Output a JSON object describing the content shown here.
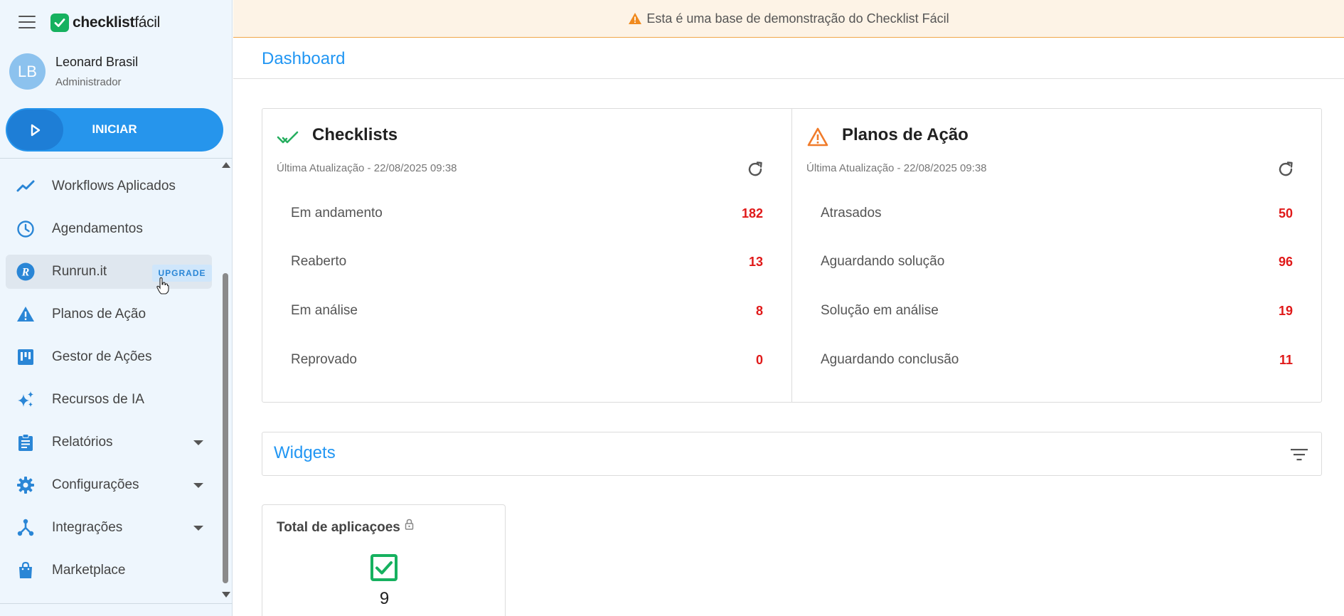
{
  "banner": {
    "text": "Esta é uma base de demonstração do Checklist Fácil"
  },
  "brand": {
    "name_bold": "checklist",
    "name_light": "fácil",
    "color": "#16b15f"
  },
  "user": {
    "initials": "LB",
    "name": "Leonard Brasil",
    "role": "Administrador"
  },
  "start_button": {
    "label": "INICIAR"
  },
  "nav": {
    "items": [
      {
        "label": "Workflows Aplicados",
        "icon": "trending-line-icon"
      },
      {
        "label": "Agendamentos",
        "icon": "clock-icon"
      },
      {
        "label": "Runrun.it",
        "icon": "runrun-logo-icon",
        "badge": "UPGRADE"
      },
      {
        "label": "Planos de Ação",
        "icon": "warning-icon"
      },
      {
        "label": "Gestor de Ações",
        "icon": "kanban-icon"
      },
      {
        "label": "Recursos de IA",
        "icon": "sparkles-icon"
      },
      {
        "label": "Relatórios",
        "icon": "clipboard-icon"
      },
      {
        "label": "Configurações",
        "icon": "gear-icon"
      },
      {
        "label": "Integrações",
        "icon": "hub-icon"
      },
      {
        "label": "Marketplace",
        "icon": "shopping-bag-icon"
      }
    ]
  },
  "page": {
    "title": "Dashboard"
  },
  "checklists": {
    "title": "Checklists",
    "updated": "Última Atualização - 22/08/2025 09:38",
    "rows": [
      {
        "label": "Em andamento",
        "value": "182"
      },
      {
        "label": "Reaberto",
        "value": "13"
      },
      {
        "label": "Em análise",
        "value": "8"
      },
      {
        "label": "Reprovado",
        "value": "0"
      }
    ]
  },
  "action_plans": {
    "title": "Planos de Ação",
    "updated": "Última Atualização - 22/08/2025 09:38",
    "rows": [
      {
        "label": "Atrasados",
        "value": "50"
      },
      {
        "label": "Aguardando solução",
        "value": "96"
      },
      {
        "label": "Solução em análise",
        "value": "19"
      },
      {
        "label": "Aguardando conclusão",
        "value": "11"
      }
    ]
  },
  "widgets": {
    "title": "Widgets"
  },
  "total_card": {
    "title": "Total de aplicaçoes",
    "value": "9"
  },
  "colors": {
    "accent": "#2196f3",
    "alert": "#e01919",
    "warning": "#f07b2a",
    "success": "#16b15f"
  }
}
